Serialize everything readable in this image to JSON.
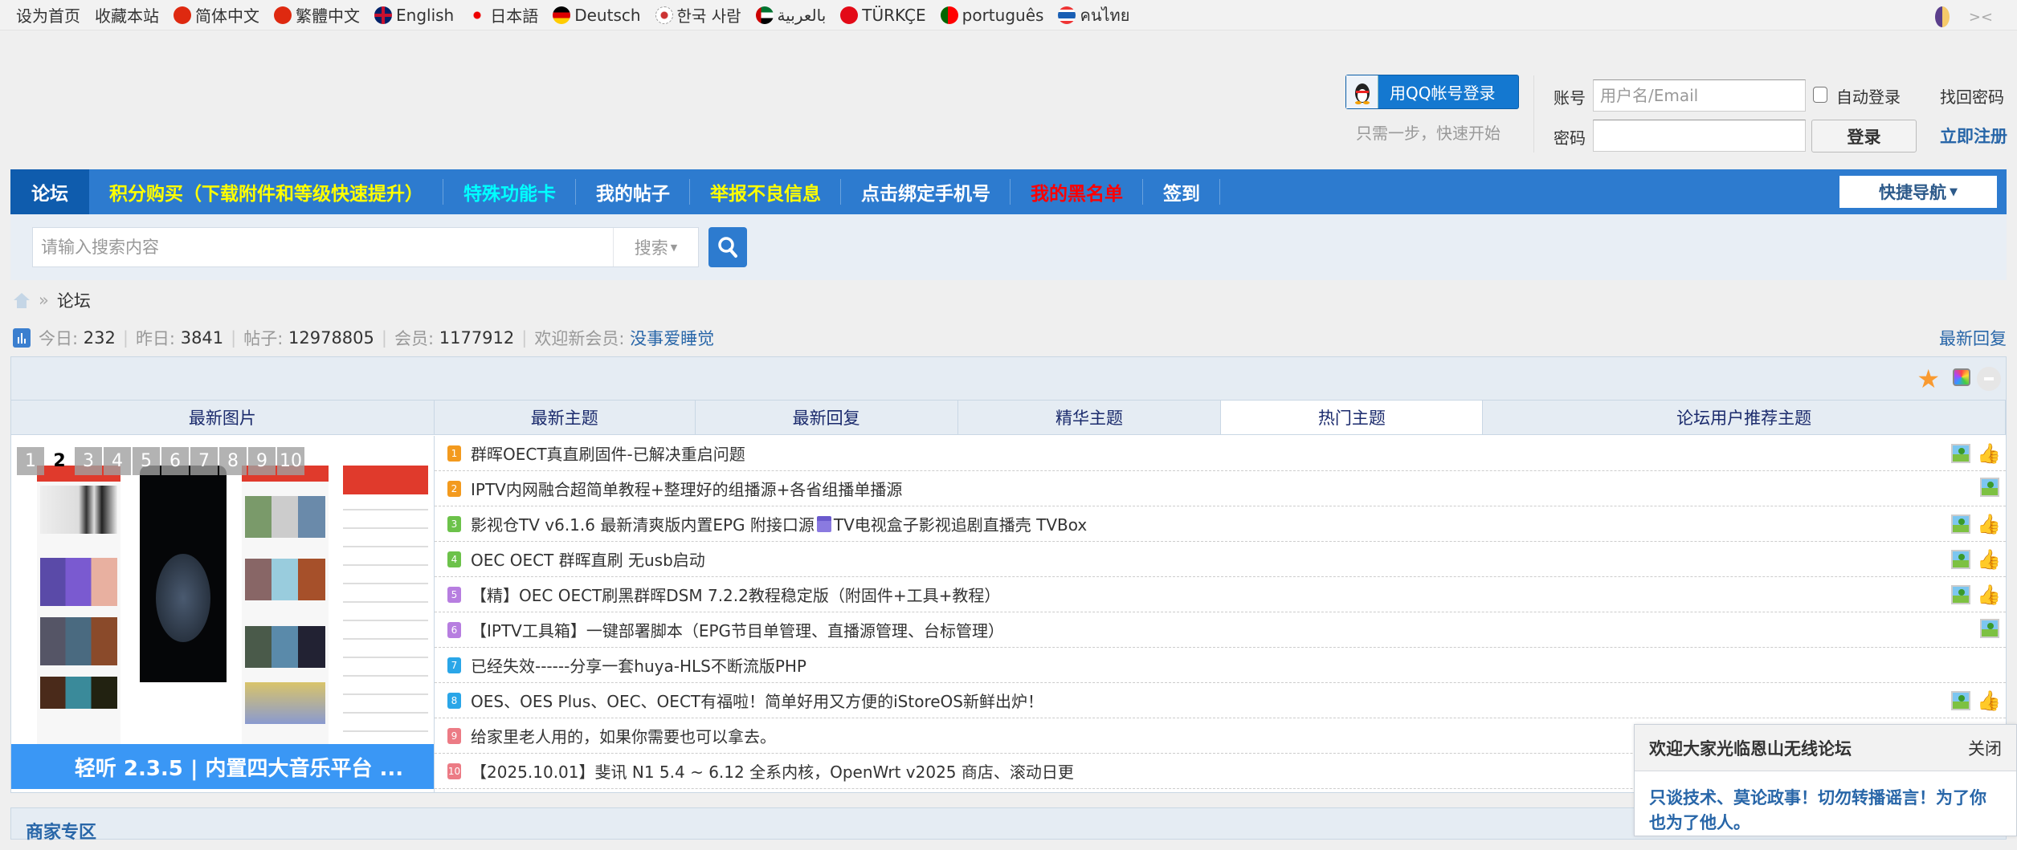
{
  "topbar": {
    "links": [
      "设为首页",
      "收藏本站"
    ],
    "languages": [
      {
        "label": "简体中文",
        "flag": "cn"
      },
      {
        "label": "繁體中文",
        "flag": "hk"
      },
      {
        "label": "English",
        "flag": "gb"
      },
      {
        "label": "日本語",
        "flag": "jp"
      },
      {
        "label": "Deutsch",
        "flag": "de"
      },
      {
        "label": "한국 사람",
        "flag": "kr"
      },
      {
        "label": "بالعربية",
        "flag": "ae"
      },
      {
        "label": "TÜRKÇE",
        "flag": "tr"
      },
      {
        "label": "português",
        "flag": "pt"
      },
      {
        "label": "คนไทย",
        "flag": "th"
      }
    ],
    "collapse": "><"
  },
  "login": {
    "qq_button": "用QQ帐号登录",
    "qq_hint": "只需一步，快速开始",
    "account_label": "账号",
    "account_placeholder": "用户名/Email",
    "auto_login": "自动登录",
    "forgot": "找回密码",
    "password_label": "密码",
    "login_button": "登录",
    "register": "立即注册"
  },
  "nav": {
    "items": [
      {
        "label": "论坛",
        "color": "#ffffff"
      },
      {
        "label": "积分购买（下载附件和等级快速提升）",
        "color": "#ffff00"
      },
      {
        "label": "特殊功能卡",
        "color": "#00ffff"
      },
      {
        "label": "我的帖子",
        "color": "#ffffff"
      },
      {
        "label": "举报不良信息",
        "color": "#ffff00"
      },
      {
        "label": "点击绑定手机号",
        "color": "#ffffff"
      },
      {
        "label": "我的黑名单",
        "color": "#ff0000"
      },
      {
        "label": "签到",
        "color": "#ffffff"
      }
    ],
    "quick_nav": "快捷导航"
  },
  "search": {
    "placeholder": "请输入搜索内容",
    "type": "搜索"
  },
  "breadcrumb": {
    "current": "论坛",
    "sep": "»"
  },
  "stats": {
    "today_label": "今日:",
    "today": "232",
    "yesterday_label": "昨日:",
    "yesterday": "3841",
    "posts_label": "帖子:",
    "posts": "12978805",
    "members_label": "会员:",
    "members": "1177912",
    "newest_label": "欢迎新会员:",
    "newest": "没事爱睡觉",
    "latest_reply": "最新回复"
  },
  "tabs": [
    {
      "label": "最新图片"
    },
    {
      "label": "最新主题"
    },
    {
      "label": "最新回复"
    },
    {
      "label": "精华主题"
    },
    {
      "label": "热门主题",
      "active": true
    },
    {
      "label": "论坛用户推荐主题"
    }
  ],
  "slider": {
    "pages": [
      "1",
      "2",
      "3",
      "4",
      "5",
      "6",
      "7",
      "8",
      "9",
      "10"
    ],
    "current": "2",
    "caption": "轻听 2.3.5 | 内置四大音乐平台 ..."
  },
  "threads": [
    {
      "n": "1",
      "title": "群晖OECT真直刷固件-已解决重启问题",
      "color": "#f39a1e",
      "img": true,
      "like": true
    },
    {
      "n": "2",
      "title": "IPTV内网融合超简单教程+整理好的组播源+各省组播单播源",
      "color": "#f39a1e",
      "img": true,
      "like": false
    },
    {
      "n": "3",
      "title": "影视仓TV v6.1.6 最新清爽版内置EPG 附接口源",
      "title2": "TV电视盒子影视追剧直播壳 TVBox",
      "color": "#6cc24a",
      "img": true,
      "like": true
    },
    {
      "n": "4",
      "title": "OEC OECT 群晖直刷 无usb启动",
      "color": "#6cc24a",
      "img": true,
      "like": true
    },
    {
      "n": "5",
      "title": "【精】OEC OECT刷黑群晖DSM 7.2.2教程稳定版（附固件+工具+教程）",
      "color": "#b77ee0",
      "img": true,
      "like": true
    },
    {
      "n": "6",
      "title": "【IPTV工具箱】一键部署脚本（EPG节目单管理、直播源管理、台标管理）",
      "color": "#b77ee0",
      "img": true,
      "like": false
    },
    {
      "n": "7",
      "title": "已经失效------分享一套huya-HLS不断流版PHP",
      "color": "#2aa6e8",
      "img": false,
      "like": false
    },
    {
      "n": "8",
      "title": "OES、OES Plus、OEC、OECT有福啦！简单好用又方便的iStoreOS新鲜出炉！",
      "color": "#2aa6e8",
      "img": true,
      "like": true
    },
    {
      "n": "9",
      "title": "给家里老人用的，如果你需要也可以拿去。",
      "color": "#ec7b85",
      "img": false,
      "like": false
    },
    {
      "n": "10",
      "title": "【2025.10.01】斐讯 N1 5.4 ~ 6.12 全系内核，OpenWrt v2025 商店、滚动日更",
      "color": "#ec7b85",
      "img": false,
      "like": false
    }
  ],
  "section2": {
    "title": "商家专区"
  },
  "popup": {
    "title": "欢迎大家光临恩山无线论坛",
    "close": "关闭",
    "body": "只谈技术、莫论政事！切勿转播谣言！为了你也为了他人。"
  }
}
